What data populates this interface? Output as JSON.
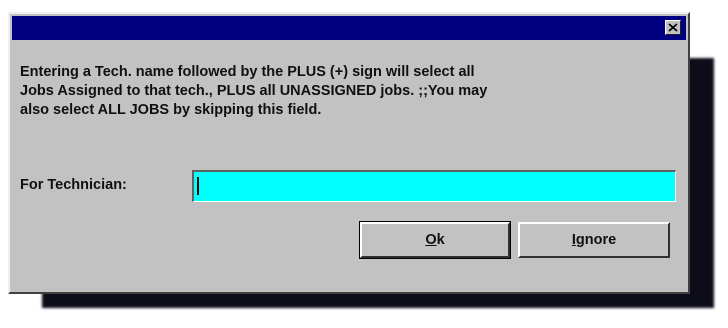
{
  "dialog": {
    "title": "",
    "close_label": "×",
    "message_lines": [
      "Entering a Tech. name followed by the PLUS (+) sign will select all",
      "Jobs Assigned to that tech., PLUS all UNASSIGNED jobs. ;;You may",
      "also select ALL JOBS by skipping this field."
    ],
    "technician": {
      "label": "For Technician:",
      "value": ""
    },
    "buttons": {
      "ok": {
        "mnemonic": "O",
        "rest": "k"
      },
      "ignore": {
        "mnemonic": "I",
        "rest": "gnore"
      }
    }
  },
  "colors": {
    "titlebar": "#000080",
    "dialog_face": "#c2c2c2",
    "input_background": "#00ffff",
    "shadow": "#0d0d1a"
  }
}
